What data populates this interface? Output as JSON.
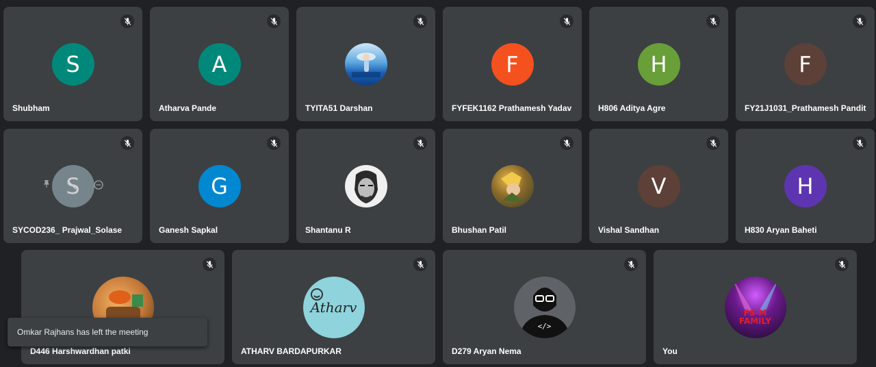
{
  "participants_row1": [
    {
      "name": "Shubham",
      "initial": "S",
      "color": "#00897b"
    },
    {
      "name": "Atharva Pande",
      "initial": "A",
      "color": "#00897b"
    },
    {
      "name": "TYITA51 Darshan",
      "initial": "",
      "color": "#6fb6e8",
      "photo": "anime-girl-sky"
    },
    {
      "name": "FYFEK1162 Prathamesh Yadav",
      "initial": "F",
      "color": "#f4511e"
    },
    {
      "name": "H806 Aditya Agre",
      "initial": "H",
      "color": "#689f38"
    },
    {
      "name": "FY21J1031_Prathamesh Pandit",
      "initial": "F",
      "color": "#5d4037"
    }
  ],
  "participants_row2": [
    {
      "name": "SYCOD236_ Prajwal_Solase",
      "initial": "S",
      "color": "#8a9ba3"
    },
    {
      "name": "Ganesh Sapkal",
      "initial": "G",
      "color": "#0288d1"
    },
    {
      "name": "Shantanu R",
      "initial": "",
      "color": "#e0e0e0",
      "photo": "sketch-portrait"
    },
    {
      "name": "Bhushan Patil",
      "initial": "",
      "color": "#6d5a2c",
      "photo": "anime-character"
    },
    {
      "name": "Vishal Sandhan",
      "initial": "V",
      "color": "#5d4037"
    },
    {
      "name": "H830 Aryan Baheti",
      "initial": "H",
      "color": "#5e35b1"
    }
  ],
  "participants_row3": [
    {
      "name": "D446 Harshwardhan patki",
      "initial": "",
      "color": "#c77a3a",
      "photo": "anime-scene"
    },
    {
      "name": "ATHARV BARDAPURKAR",
      "initial": "",
      "color": "#8fd3dc",
      "photo": "atharv-logo",
      "logo_text": "Atharv"
    },
    {
      "name": "D279 Aryan Nema",
      "initial": "",
      "color": "#5f6368",
      "photo": "coder-avatar",
      "code_text": "</>"
    },
    {
      "name": "You",
      "initial": "",
      "color": "#2a0a3a",
      "photo": "fsm-family",
      "logo_text": "FS-M FAMILY"
    }
  ],
  "toast": {
    "message": "Omkar Rajhans has left the meeting"
  },
  "icons": {
    "mic": "mic-off-icon",
    "pin": "pin-icon",
    "remove": "remove-icon"
  }
}
